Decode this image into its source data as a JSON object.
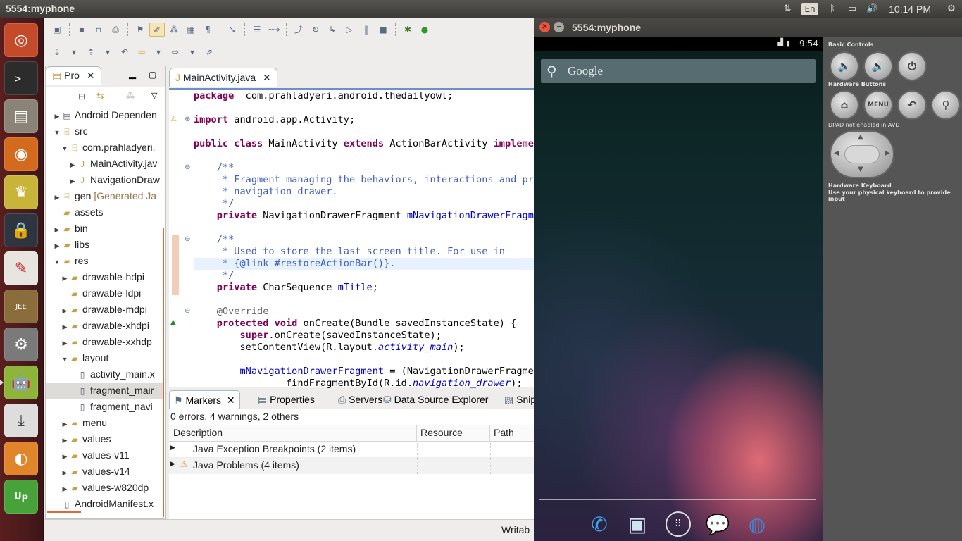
{
  "topbar": {
    "title": "5554:myphone",
    "lang": "En",
    "clock": "10:14 PM"
  },
  "launcher": {
    "items": [
      "ubuntu-logo-icon",
      "terminal-icon",
      "file-manager-icon",
      "firefox-icon",
      "cup-icon",
      "lock-icon",
      "text-editor-icon",
      "javaee-ide-icon",
      "settings-icon",
      "android-icon",
      "install-icon",
      "sound-juicer-icon",
      "upwork-icon"
    ]
  },
  "package_explorer": {
    "tab_label": "Pro",
    "tree": [
      {
        "label": "Android Dependen",
        "indent": 0,
        "arrow": "▶",
        "icon": "lib"
      },
      {
        "label": "src",
        "indent": 0,
        "arrow": "▼",
        "icon": "pkg"
      },
      {
        "label": "com.prahladyeri.",
        "indent": 1,
        "arrow": "▼",
        "icon": "pkg"
      },
      {
        "label": "MainActivity.jav",
        "indent": 2,
        "arrow": "▶",
        "icon": "java"
      },
      {
        "label": "NavigationDraw",
        "indent": 2,
        "arrow": "▶",
        "icon": "java"
      },
      {
        "label": "gen",
        "extra": "[Generated Ja",
        "indent": 0,
        "arrow": "▶",
        "icon": "pkg"
      },
      {
        "label": "assets",
        "indent": 0,
        "arrow": "",
        "icon": "folder"
      },
      {
        "label": "bin",
        "indent": 0,
        "arrow": "▶",
        "icon": "folder"
      },
      {
        "label": "libs",
        "indent": 0,
        "arrow": "▶",
        "icon": "folder"
      },
      {
        "label": "res",
        "indent": 0,
        "arrow": "▼",
        "icon": "folder"
      },
      {
        "label": "drawable-hdpi",
        "indent": 1,
        "arrow": "▶",
        "icon": "folder"
      },
      {
        "label": "drawable-ldpi",
        "indent": 1,
        "arrow": "",
        "icon": "folder"
      },
      {
        "label": "drawable-mdpi",
        "indent": 1,
        "arrow": "▶",
        "icon": "folder"
      },
      {
        "label": "drawable-xhdpi",
        "indent": 1,
        "arrow": "▶",
        "icon": "folder"
      },
      {
        "label": "drawable-xxhdp",
        "indent": 1,
        "arrow": "▶",
        "icon": "folder"
      },
      {
        "label": "layout",
        "indent": 1,
        "arrow": "▼",
        "icon": "folder"
      },
      {
        "label": "activity_main.x",
        "indent": 2,
        "arrow": "",
        "icon": "xml"
      },
      {
        "label": "fragment_mair",
        "indent": 2,
        "arrow": "",
        "icon": "xml",
        "selected": true
      },
      {
        "label": "fragment_navi",
        "indent": 2,
        "arrow": "",
        "icon": "xml"
      },
      {
        "label": "menu",
        "indent": 1,
        "arrow": "▶",
        "icon": "folder"
      },
      {
        "label": "values",
        "indent": 1,
        "arrow": "▶",
        "icon": "folder"
      },
      {
        "label": "values-v11",
        "indent": 1,
        "arrow": "▶",
        "icon": "folder"
      },
      {
        "label": "values-v14",
        "indent": 1,
        "arrow": "▶",
        "icon": "folder"
      },
      {
        "label": "values-w820dp",
        "indent": 1,
        "arrow": "▶",
        "icon": "folder"
      },
      {
        "label": "AndroidManifest.x",
        "indent": 0,
        "arrow": "",
        "icon": "xml"
      }
    ]
  },
  "editor": {
    "tab_label": "MainActivity.java",
    "lines": [
      [
        [
          "kw",
          "package"
        ],
        [
          "",
          "  com.prahladyeri.android.thedailyowl;"
        ]
      ],
      [],
      [
        [
          "kw",
          "import"
        ],
        [
          "",
          " android.app.Activity;"
        ]
      ],
      [],
      [
        [
          "kw",
          "public"
        ],
        [
          "",
          " "
        ],
        [
          "kw",
          "class"
        ],
        [
          "",
          " MainActivity "
        ],
        [
          "kw",
          "extends"
        ],
        [
          "",
          " ActionBarActivity "
        ],
        [
          "kw",
          "implement"
        ]
      ],
      [],
      [
        [
          "jd",
          "    /**"
        ]
      ],
      [
        [
          "jd",
          "     * Fragment managing the behaviors, interactions and pres"
        ]
      ],
      [
        [
          "jd",
          "     * navigation drawer."
        ]
      ],
      [
        [
          "jd",
          "     */"
        ]
      ],
      [
        [
          "kw",
          "    private"
        ],
        [
          "",
          " NavigationDrawerFragment "
        ],
        [
          "fld",
          "mNavigationDrawerFragmen"
        ]
      ],
      [],
      [
        [
          "jd",
          "    /**"
        ]
      ],
      [
        [
          "jd",
          "     * Used to store the last screen title. For use in"
        ]
      ],
      [
        [
          "jd",
          "     * {@link #restoreActionBar()}."
        ]
      ],
      [
        [
          "jd",
          "     */"
        ]
      ],
      [
        [
          "kw",
          "    private"
        ],
        [
          "",
          " CharSequence "
        ],
        [
          "fld",
          "mTitle"
        ],
        [
          "",
          ";"
        ]
      ],
      [],
      [
        [
          "ann",
          "    @Override"
        ]
      ],
      [
        [
          "kw",
          "    protected"
        ],
        [
          "",
          " "
        ],
        [
          "kw",
          "void"
        ],
        [
          "",
          " onCreate(Bundle savedInstanceState) {"
        ]
      ],
      [
        [
          "kw",
          "        super"
        ],
        [
          "",
          ".onCreate(savedInstanceState);"
        ]
      ],
      [
        [
          "",
          "        setContentView(R.layout."
        ],
        [
          "it",
          "activity_main"
        ],
        [
          "",
          ");"
        ]
      ],
      [],
      [
        [
          "fld",
          "        mNavigationDrawerFragment"
        ],
        [
          "",
          " = (NavigationDrawerFragment"
        ]
      ],
      [
        [
          "",
          "                findFragmentById(R.id."
        ],
        [
          "it",
          "navigation_drawer"
        ],
        [
          "",
          ");"
        ]
      ]
    ]
  },
  "markers": {
    "tabs": [
      "Markers",
      "Properties",
      "Servers",
      "Data Source Explorer",
      "Snip"
    ],
    "summary": "0 errors, 4 warnings, 2 others",
    "columns": [
      "Description",
      "Resource",
      "Path"
    ],
    "rows": [
      "Java Exception Breakpoints (2 items)",
      "Java Problems (4 items)"
    ]
  },
  "statusbar": {
    "text": "Writab"
  },
  "emulator": {
    "title": "5554:myphone",
    "phone_time": "9:54",
    "search_placeholder": "Google",
    "controls": {
      "basic": "Basic Controls",
      "hardware": "Hardware Buttons",
      "menu_label": "MENU",
      "dpad": "DPAD not enabled in AVD",
      "keyboard": "Hardware Keyboard",
      "keyboard_hint": "Use your physical keyboard to provide input"
    }
  }
}
